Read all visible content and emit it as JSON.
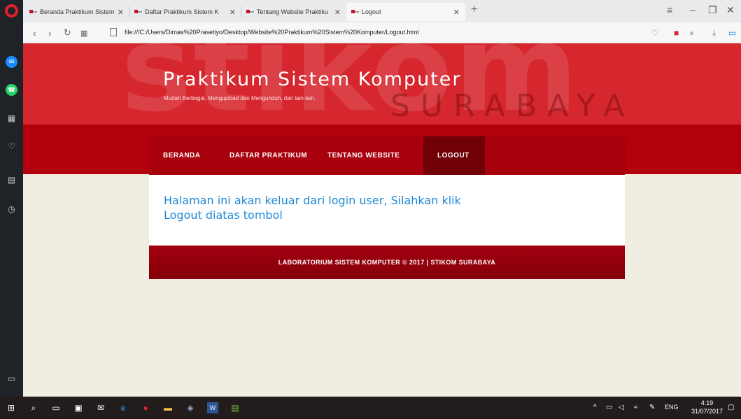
{
  "browser": {
    "tabs": [
      {
        "label": "Beranda Praktikum Sistem",
        "close": "✕"
      },
      {
        "label": "Daftar Praktikum Sistem K",
        "close": "✕"
      },
      {
        "label": "Tentang Website Praktiku",
        "close": "✕"
      },
      {
        "label": "Logout",
        "close": "✕"
      }
    ],
    "new_tab": "+",
    "url": "file:///C:/Users/Dimas%20Prasetiyo/Desktop/Website%20Praktikum%20Sistem%20Komputer/Logout.html"
  },
  "site": {
    "title": "Praktikum Sistem Komputer",
    "tagline": "Mudah Berbagai, Mengupload dan Mengunduh, dan lain-lain.",
    "watermark_big": "stikom",
    "watermark_small": "SURABAYA",
    "nav": [
      {
        "label": "BERANDA"
      },
      {
        "label": "DAFTAR PRAKTIKUM"
      },
      {
        "label": "TENTANG WEBSITE"
      },
      {
        "label": "LOGOUT",
        "active": true
      }
    ],
    "message": "Halaman ini akan keluar dari login user, Silahkan klik Logout diatas tombol",
    "footer": "LABORATORIUM SISTEM KOMPUTER © 2017 | STIKOM SURABAYA"
  },
  "taskbar": {
    "language": "ENG",
    "time": "4:19",
    "date": "31/07/2017"
  },
  "colors": {
    "header_red": "#d6262e",
    "nav_red": "#a8000c",
    "nav_active": "#700006",
    "link_blue": "#1e88d6",
    "page_bg": "#f0ede3"
  }
}
